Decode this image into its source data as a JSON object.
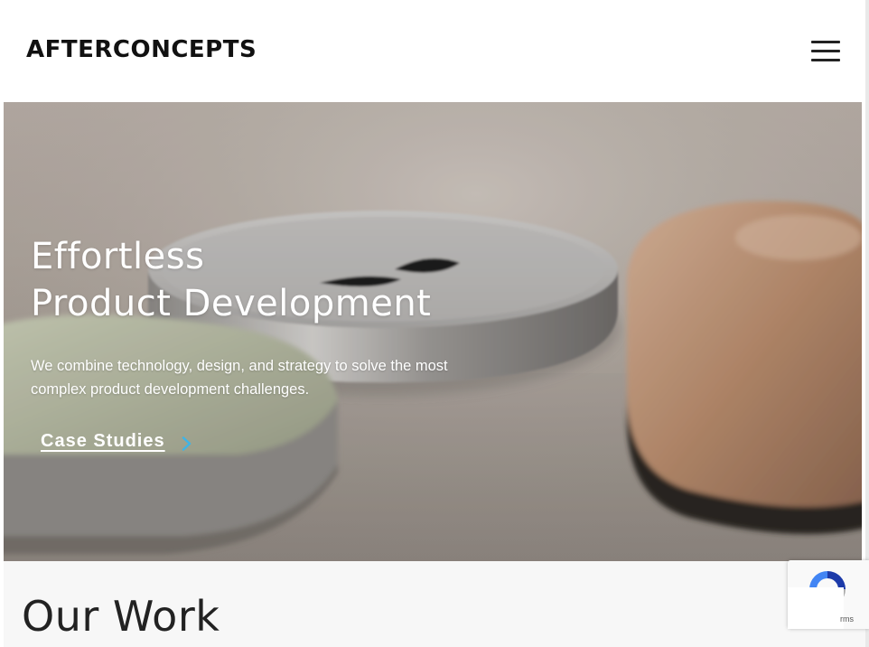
{
  "header": {
    "logo_text": "AFTERCONCEPTS",
    "menu_icon": "hamburger-menu-icon"
  },
  "hero": {
    "title_line1": "Effortless",
    "title_line2": "Product Development",
    "subtitle_line1": "We combine technology, design, and strategy to solve the most",
    "subtitle_line2": "complex product development challenges.",
    "cta_label": "Case Studies",
    "cta_icon": "chevron-right-icon",
    "colors": {
      "accent": "#3fb4e6",
      "text": "#ffffff"
    }
  },
  "work_section": {
    "title": "Our Work"
  },
  "recaptcha": {
    "icon": "recaptcha-icon",
    "terms_text": "rms"
  }
}
